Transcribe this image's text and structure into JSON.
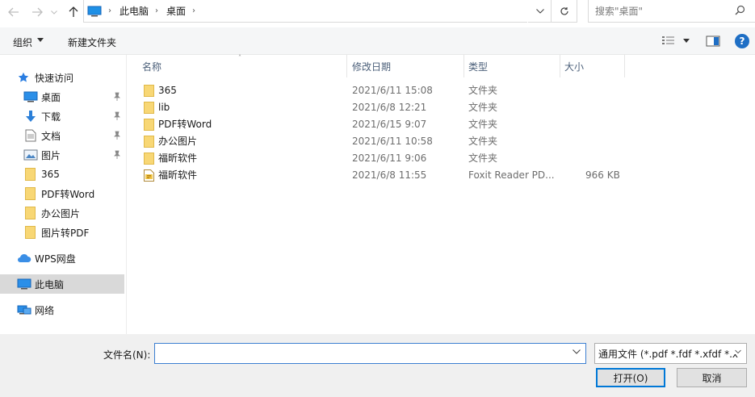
{
  "address": {
    "breadcrumbs": [
      "此电脑",
      "桌面"
    ]
  },
  "search": {
    "placeholder": "搜索\"桌面\""
  },
  "toolbar": {
    "organize_label": "组织",
    "new_folder_label": "新建文件夹"
  },
  "nav": {
    "quick_access": "快速访问",
    "items": [
      {
        "label": "桌面",
        "icon": "desktop-icon",
        "pinned": true
      },
      {
        "label": "下载",
        "icon": "download-icon",
        "pinned": true
      },
      {
        "label": "文档",
        "icon": "document-icon",
        "pinned": true
      },
      {
        "label": "图片",
        "icon": "picture-icon",
        "pinned": true
      },
      {
        "label": "365",
        "icon": "folder-icon",
        "pinned": false
      },
      {
        "label": "PDF转Word",
        "icon": "folder-icon",
        "pinned": false
      },
      {
        "label": "办公图片",
        "icon": "folder-icon",
        "pinned": false
      },
      {
        "label": "图片转PDF",
        "icon": "folder-icon",
        "pinned": false
      }
    ],
    "wps_cloud": "WPS网盘",
    "this_pc": "此电脑",
    "network": "网络"
  },
  "columns": {
    "name": "名称",
    "modified": "修改日期",
    "type": "类型",
    "size": "大小"
  },
  "files": [
    {
      "name": "365",
      "modified": "2021/6/11 15:08",
      "type": "文件夹",
      "size": "",
      "icon": "folder-icon"
    },
    {
      "name": "lib",
      "modified": "2021/6/8 12:21",
      "type": "文件夹",
      "size": "",
      "icon": "folder-icon"
    },
    {
      "name": "PDF转Word",
      "modified": "2021/6/15 9:07",
      "type": "文件夹",
      "size": "",
      "icon": "folder-icon"
    },
    {
      "name": "办公图片",
      "modified": "2021/6/11 10:58",
      "type": "文件夹",
      "size": "",
      "icon": "folder-icon"
    },
    {
      "name": "福昕软件",
      "modified": "2021/6/11 9:06",
      "type": "文件夹",
      "size": "",
      "icon": "folder-icon"
    },
    {
      "name": "福昕软件",
      "modified": "2021/6/8 11:55",
      "type": "Foxit Reader PD...",
      "size": "966 KB",
      "icon": "pdf-file-icon"
    }
  ],
  "footer": {
    "filename_label": "文件名(N):",
    "filename_value": "",
    "filetype_value": "通用文件 (*.pdf *.fdf *.xfdf *.x",
    "open_label": "打开(O)",
    "cancel_label": "取消"
  },
  "colors": {
    "accent": "#0078d7",
    "folder": "#f8d775",
    "selected_nav": "#d9d9d9",
    "header_text": "#4c607a"
  }
}
